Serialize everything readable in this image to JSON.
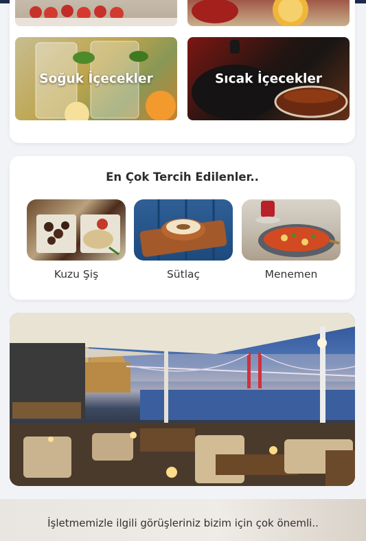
{
  "categories": {
    "items": [
      {
        "label": ""
      },
      {
        "label": ""
      },
      {
        "label": "Soğuk İçecekler"
      },
      {
        "label": "Sıcak İçecekler"
      }
    ]
  },
  "favorites": {
    "title": "En Çok Tercih Edilenler..",
    "items": [
      {
        "name": "Kuzu Şiş"
      },
      {
        "name": "Sütlaç"
      },
      {
        "name": "Menemen"
      }
    ]
  },
  "feedback": {
    "text": "İşletmemizle ilgili görüşleriniz bizim için çok önemli.."
  },
  "colors": {
    "topbar": "#1c2a4d",
    "card_bg": "#ffffff",
    "page_bg": "#f2f3f7"
  }
}
